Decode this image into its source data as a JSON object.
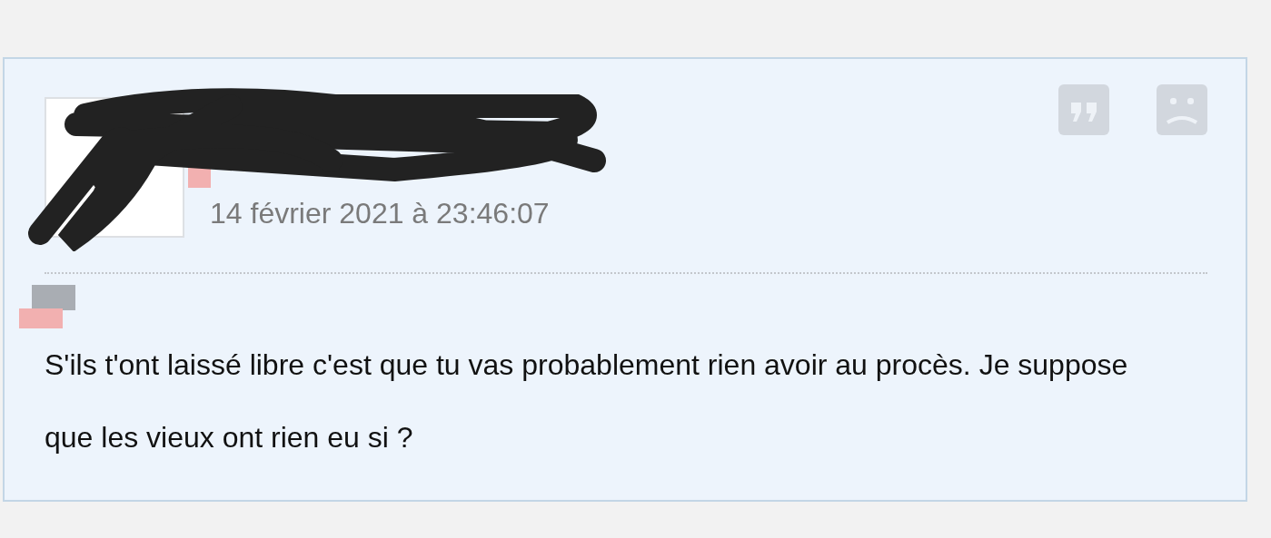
{
  "post": {
    "date": "14 février 2021 à 23:46:07",
    "body": "S'ils t'ont laissé libre c'est que tu vas probablement rien avoir au procès. Je suppose que les vieux ont rien eu si ?",
    "actions": [
      {
        "kind": "quote"
      },
      {
        "kind": "report"
      }
    ]
  }
}
